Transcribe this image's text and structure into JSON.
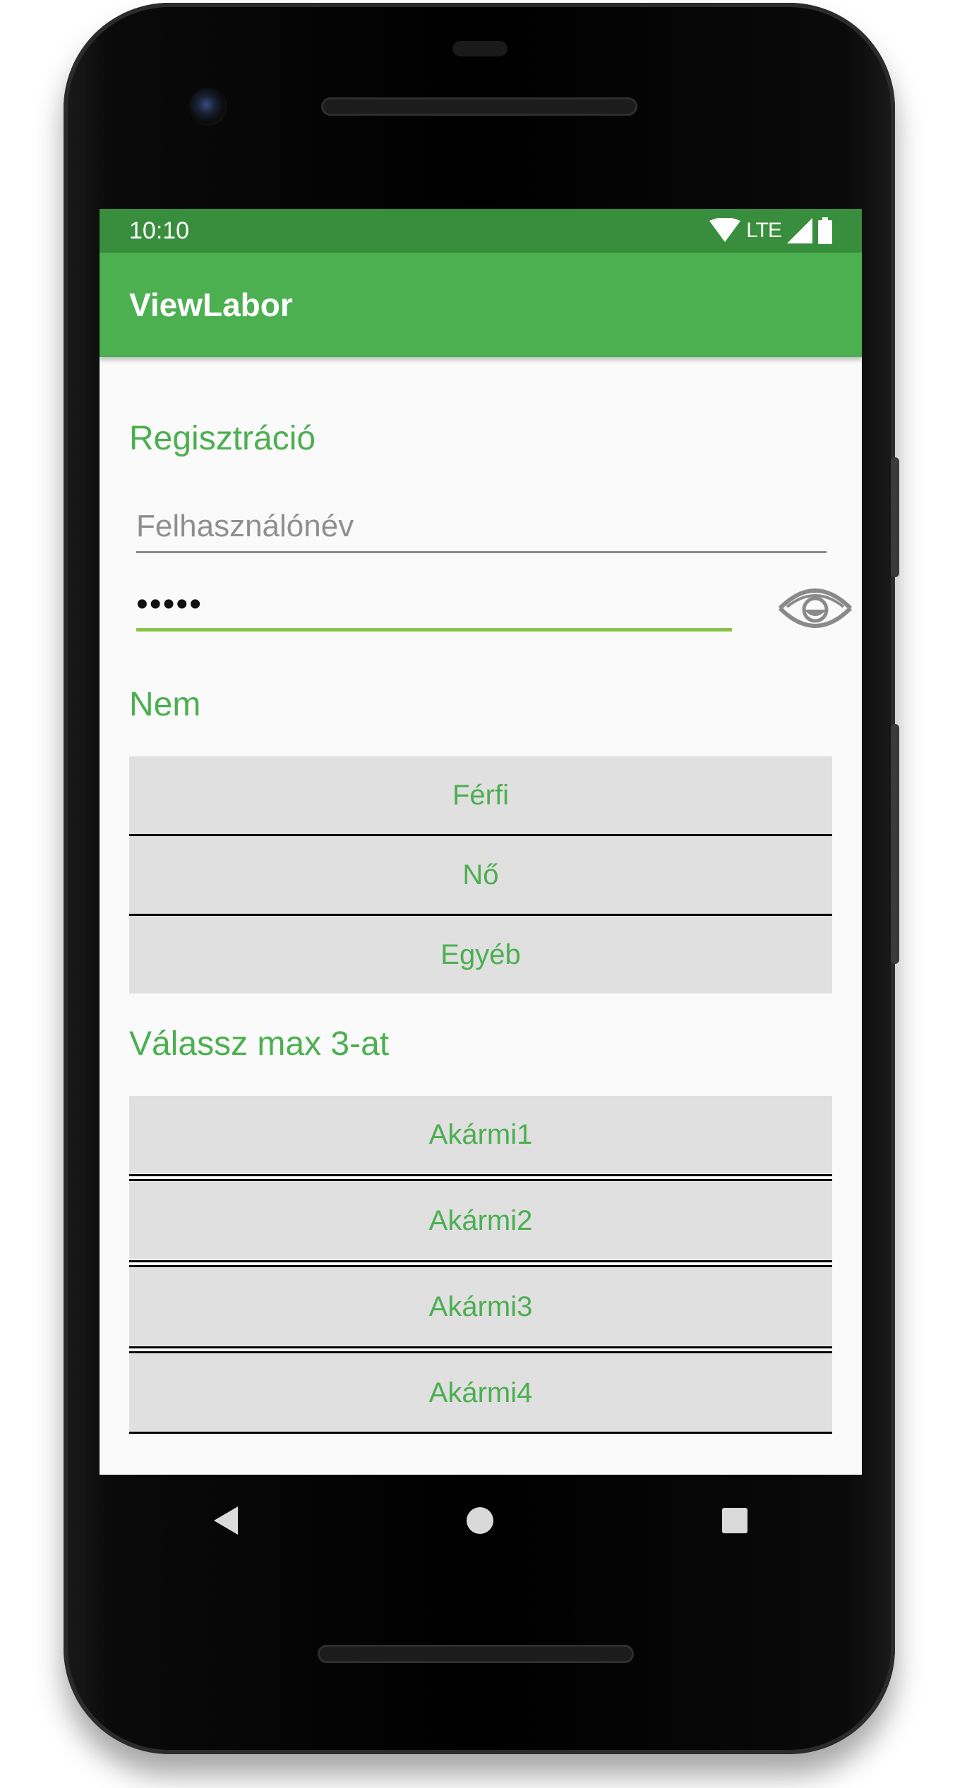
{
  "status_bar": {
    "time": "10:10",
    "network": "LTE"
  },
  "app_bar": {
    "title": "ViewLabor"
  },
  "form": {
    "registration_title": "Regisztráció",
    "username_placeholder": "Felhasználónév",
    "password_value": "•••••",
    "gender_title": "Nem",
    "gender_options": [
      {
        "label": "Férfi"
      },
      {
        "label": "Nő"
      },
      {
        "label": "Egyéb"
      }
    ],
    "choice_title": "Válassz max 3-at",
    "choice_options": [
      {
        "label": "Akármi1"
      },
      {
        "label": "Akármi2"
      },
      {
        "label": "Akármi3"
      },
      {
        "label": "Akármi4"
      }
    ]
  },
  "icons": {
    "show_password": "eye-icon",
    "wifi": "wifi-icon",
    "signal": "signal-icon",
    "battery": "battery-icon",
    "back": "back-icon",
    "home": "home-icon",
    "recents": "recents-icon"
  },
  "colors": {
    "primary": "#4caf50",
    "primary_dark": "#388e3c",
    "accent": "#8bc34a",
    "button_bg": "#e0e0e0"
  }
}
